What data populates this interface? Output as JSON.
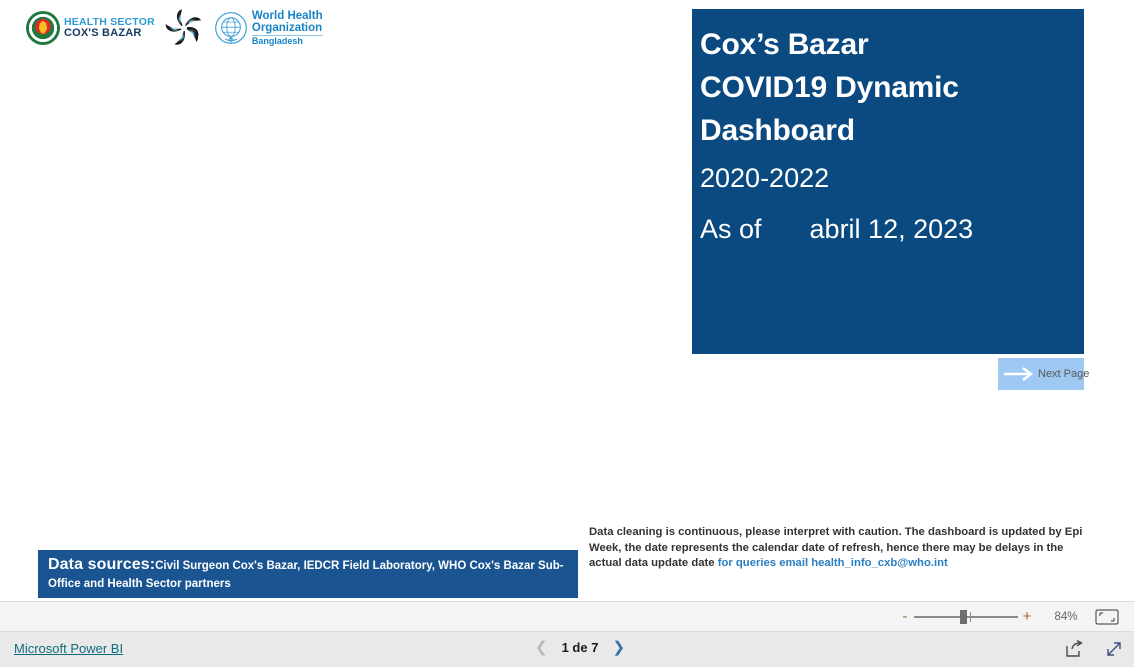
{
  "header": {
    "logos": [
      {
        "name": "health-sector-coxs-bazar",
        "line1": "HEALTH SECTOR",
        "line2": "COX'S BAZAR"
      },
      {
        "name": "swirl-mark",
        "alt": "swirl-logo"
      },
      {
        "name": "world-health-organization",
        "line1": "World Health",
        "line2": "Organization",
        "line3": "Bangladesh"
      }
    ]
  },
  "title_card": {
    "line1": "Cox’s Bazar",
    "line2": "COVID19 Dynamic",
    "line3": "Dashboard",
    "years": "2020-2022",
    "as_of_label": "As of",
    "as_of_date": "abril 12, 2023",
    "background_color": "#0b4a80"
  },
  "next_page": {
    "label": "Next Page",
    "icon": "arrow-right-icon",
    "background_color": "#9fc9f3"
  },
  "data_sources": {
    "label": "Data sources:",
    "text": "Civil Surgeon Cox's Bazar, IEDCR Field Laboratory, WHO Cox's Bazar Sub-Office and Health Sector partners",
    "background_color": "#1a5591"
  },
  "caption": {
    "text": "Data cleaning is continuous, please interpret with caution. The dashboard is updated by Epi Week, the date represents the calendar date of refresh, hence there may be delays in the actual data update date ",
    "link_text": "for queries email health_info_cxb@who.int",
    "link_color": "#2a7ec2"
  },
  "zoom_toolbar": {
    "minus": "-",
    "plus": "+",
    "percent": "84%",
    "fit_icon": "fit-to-page-icon"
  },
  "status_bar": {
    "brand_link": "Microsoft Power BI",
    "prev_icon": "chevron-left-icon",
    "next_icon": "chevron-right-icon",
    "page_label": "1 de 7",
    "share_icon": "share-icon",
    "fullscreen_icon": "fullscreen-icon"
  }
}
